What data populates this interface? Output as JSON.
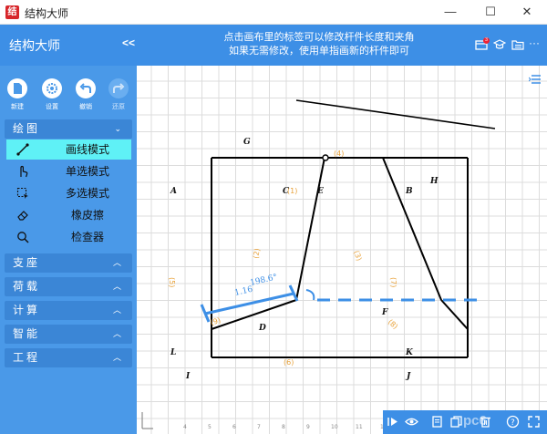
{
  "window": {
    "title": "结构大师",
    "app_icon": "structure-master-icon",
    "minimize": "—",
    "maximize": "☐",
    "close": "✕"
  },
  "header": {
    "app_name": "结构大师",
    "collapse": "<<",
    "hint_line1": "点击画布里的标签可以修改杆件长度和夹角",
    "hint_line2": "如果无需修改，使用单指画新的杆件即可",
    "badge": "3",
    "more": "···"
  },
  "toolbar": {
    "new_label": "新建",
    "settings_label": "设置",
    "undo_label": "撤销",
    "redo_label": "还原"
  },
  "sections": {
    "draw": "绘图",
    "support": "支座",
    "load": "荷载",
    "compute": "计算",
    "smart": "智能",
    "project": "工程"
  },
  "draw_items": [
    "画线模式",
    "单选模式",
    "多选模式",
    "橡皮擦",
    "检查器"
  ],
  "canvas_labels": {
    "G": "G",
    "A": "A",
    "C": "C",
    "E": "E",
    "B": "B",
    "H": "H",
    "D": "D",
    "F": "F",
    "L": "L",
    "K": "K",
    "I": "I",
    "J": "J",
    "m1": "(1)",
    "m2": "(2)",
    "m3": "(3)",
    "m4": "(4)",
    "m5": "(5)",
    "m6": "(6)",
    "m7": "(7)",
    "m8": "(8)",
    "m9": "(9)",
    "angle": "198.6°",
    "length": "1.16"
  },
  "axis_ticks": [
    "4",
    "5",
    "6",
    "7",
    "8",
    "9",
    "10",
    "11",
    "12",
    "13"
  ],
  "watermark": "pc6",
  "colors": {
    "header_blue": "#3d8fe6",
    "sidebar_blue": "#4a99e8",
    "active_cyan": "#5ff1f6",
    "member_label": "#e8a23a",
    "measure_blue": "#3d8fe6"
  }
}
